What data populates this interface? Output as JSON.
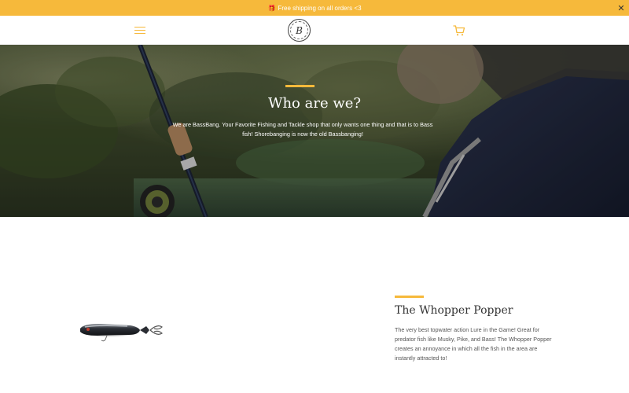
{
  "announcement": {
    "text": "Free shipping on all orders <3",
    "gift_glyph": "🎁",
    "close_glyph": "✕"
  },
  "header": {
    "logo_letter": "B",
    "menu_icon": "hamburger-icon",
    "cart_icon": "cart-icon"
  },
  "hero": {
    "title": "Who are we?",
    "text": "We are BassBang. Your Favorite Fishing and Tackle shop that only wants one thing and that is to Bass fish! Shorebanging is now the old Bassbanging!"
  },
  "product": {
    "title": "The Whopper Popper",
    "description": "The very best topwater action Lure in the Game! Great for predator fish like Musky, Pike, and Bass! The Whopper Popper creates an annoyance in which all the fish in the area are instantly attracted to!"
  },
  "colors": {
    "accent": "#f6b93b",
    "text": "#333333",
    "background": "#ffffff"
  }
}
